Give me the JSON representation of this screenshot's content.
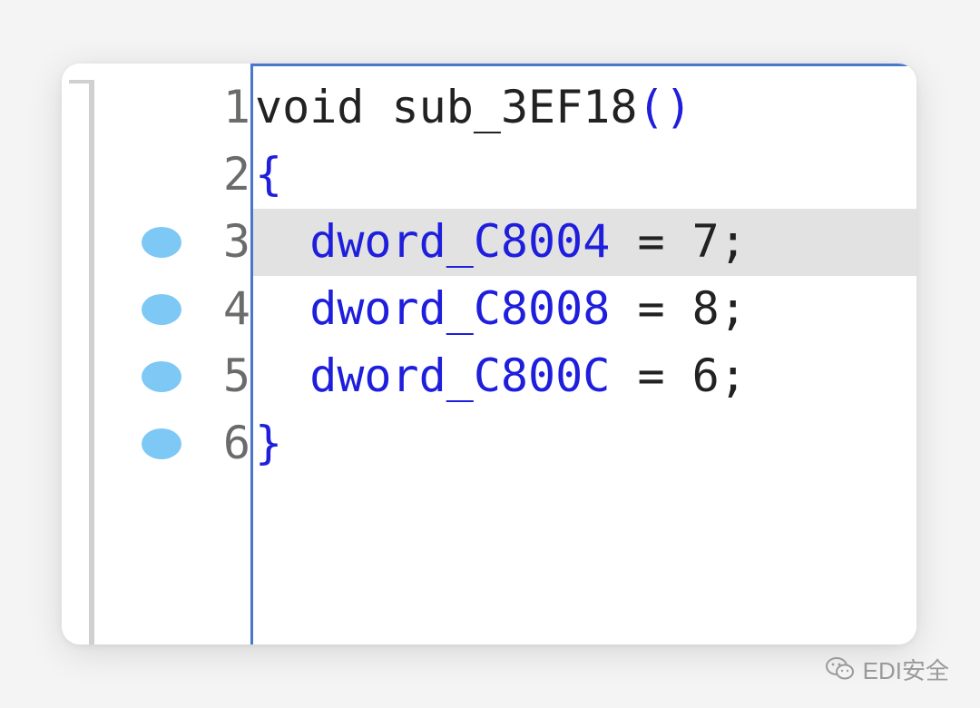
{
  "editor": {
    "lines": [
      {
        "number": "1",
        "breakpoint": false,
        "highlighted": false,
        "tokens": {
          "kw": "void",
          "sp1": " ",
          "name": "sub_3EF18",
          "paren": "()"
        }
      },
      {
        "number": "2",
        "breakpoint": false,
        "highlighted": false,
        "tokens": {
          "brace": "{"
        }
      },
      {
        "number": "3",
        "breakpoint": true,
        "highlighted": true,
        "tokens": {
          "indent": "  ",
          "var": "dword_C8004",
          "op": " = ",
          "val": "7",
          "semi": ";"
        }
      },
      {
        "number": "4",
        "breakpoint": true,
        "highlighted": false,
        "tokens": {
          "indent": "  ",
          "var": "dword_C8008",
          "op": " = ",
          "val": "8",
          "semi": ";"
        }
      },
      {
        "number": "5",
        "breakpoint": true,
        "highlighted": false,
        "tokens": {
          "indent": "  ",
          "var": "dword_C800C",
          "op": " = ",
          "val": "6",
          "semi": ";"
        }
      },
      {
        "number": "6",
        "breakpoint": true,
        "highlighted": false,
        "tokens": {
          "brace": "}"
        }
      }
    ]
  },
  "colors": {
    "identifier": "#1e1edc",
    "keyword": "#222222",
    "line_number": "#6b6b6b",
    "breakpoint": "#7ec8f5",
    "highlight_row": "#e2e2e2",
    "gutter_border": "#4a78c8"
  },
  "watermark": {
    "icon": "wechat-icon",
    "text": "EDI安全"
  }
}
